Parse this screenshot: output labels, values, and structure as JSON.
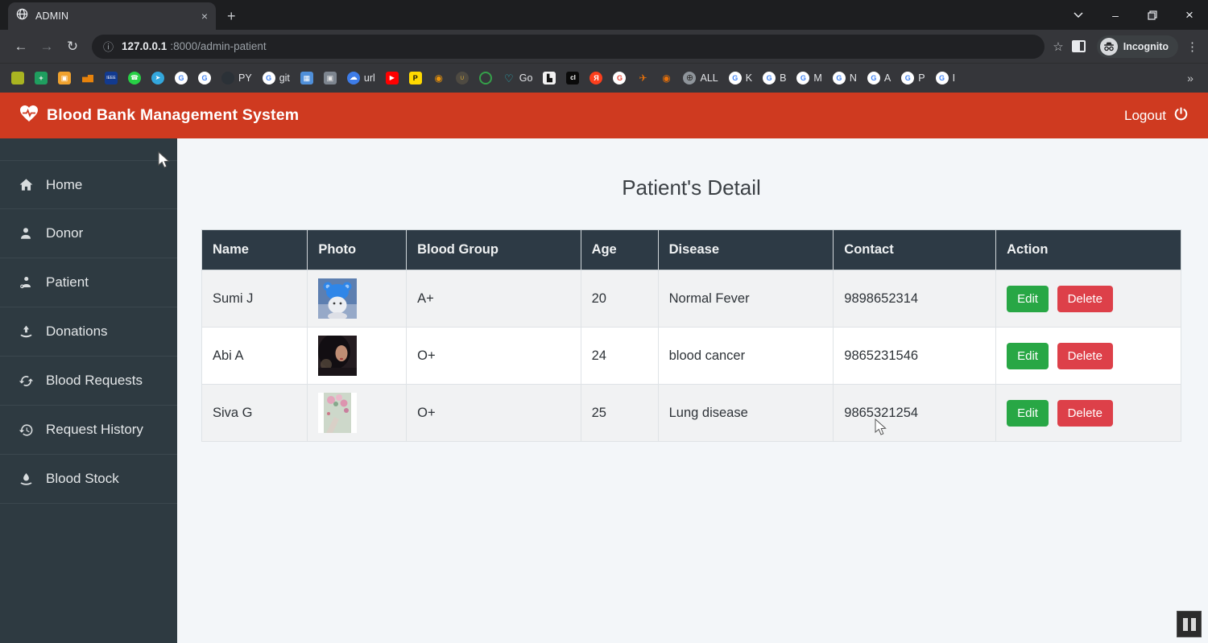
{
  "colors": {
    "accent_red": "#cf3a20",
    "sidebar_bg": "#2e3a41",
    "table_header_bg": "#2d3a45",
    "edit_green": "#28a745",
    "delete_red": "#dd4049",
    "content_bg": "#f3f6f9"
  },
  "icons": {
    "back": "←",
    "forward": "→",
    "reload": "↻",
    "info": "ⓘ",
    "star": "☆",
    "menu": "⋮",
    "minimize": "–",
    "close": "×",
    "new_tab": "+",
    "tab_close": "×"
  },
  "browser": {
    "tab_title": "ADMIN",
    "url": {
      "host": "127.0.0.1",
      "rest": ":8000/admin-patient"
    },
    "incognito_label": "Incognito",
    "bookmarks": [
      {
        "n": "tilted-bars-icon",
        "shape": "square",
        "bg": "#a9b421",
        "g": "",
        "fg": "#2f5d3a"
      },
      {
        "n": "sheets-icon",
        "shape": "square",
        "bg": "#1f9e5f",
        "g": "+",
        "fg": "#ffffff",
        "bold": 1
      },
      {
        "n": "orange-badge-icon",
        "shape": "square",
        "bg": "#f0a22e",
        "g": "▣",
        "fg": "#ffffff"
      },
      {
        "n": "analytics-icon",
        "shape": "none",
        "g": "▅▇",
        "fg": "#e8830c",
        "gs": 9
      },
      {
        "n": "ieee-icon",
        "shape": "square",
        "bg": "#123a8f",
        "g": "IEEE",
        "fg": "#ffffff",
        "gs": 5
      },
      {
        "n": "whatsapp-icon",
        "shape": "circle",
        "bg": "#27d045",
        "g": "☎",
        "fg": "#ffffff",
        "gs": 8
      },
      {
        "n": "telegram-icon",
        "shape": "circle",
        "bg": "#33a7dd",
        "g": "➤",
        "fg": "#ffffff",
        "gs": 8
      },
      {
        "n": "google-icon",
        "shape": "circle",
        "bg": "#ffffff",
        "g": "G",
        "fg": "#4285f4",
        "bold": 1
      },
      {
        "n": "google-icon",
        "shape": "circle",
        "bg": "#ffffff",
        "g": "G",
        "fg": "#4285f4",
        "bold": 1
      },
      {
        "n": "github-icon",
        "shape": "circle",
        "bg": "#2b3137",
        "g": "",
        "t": "PY"
      },
      {
        "n": "google-git-icon",
        "shape": "circle",
        "bg": "#ffffff",
        "g": "G",
        "fg": "#4285f4",
        "bold": 1,
        "t": "git"
      },
      {
        "n": "film-icon",
        "shape": "square",
        "bg": "#4f8fd9",
        "g": "▦",
        "fg": "#ffffff"
      },
      {
        "n": "camera-icon",
        "shape": "square",
        "bg": "#7d858f",
        "g": "▣",
        "fg": "#e9e9e9"
      },
      {
        "n": "cloud-url-icon",
        "shape": "circle",
        "bg": "#3d7ce8",
        "g": "☁",
        "fg": "#ffffff",
        "gs": 10,
        "t": "url"
      },
      {
        "n": "youtube-icon",
        "shape": "square",
        "bg": "#ff0000",
        "g": "▶",
        "fg": "#ffffff",
        "gs": 8
      },
      {
        "n": "p-icon",
        "shape": "square",
        "bg": "#ffd900",
        "g": "P",
        "fg": "#111111",
        "bold": 1
      },
      {
        "n": "movie-camera-icon",
        "shape": "none",
        "g": "◉",
        "fg": "#e8930c",
        "gs": 12
      },
      {
        "n": "cart-icon",
        "shape": "circle",
        "bg": "#4e4a42",
        "g": "∪",
        "fg": "#cfa43a",
        "gs": 8
      },
      {
        "n": "ring-icon",
        "shape": "ring",
        "border": "#35a04a"
      },
      {
        "n": "godaddy-icon",
        "shape": "none",
        "g": "♡",
        "fg": "#27b0bb",
        "gs": 13,
        "t": "Go"
      },
      {
        "n": "eagle-doc-icon",
        "shape": "square",
        "bg": "#f2f2f2",
        "g": "▙",
        "fg": "#141414"
      },
      {
        "n": "cl-icon",
        "shape": "square",
        "bg": "#0a0a0a",
        "g": "cl",
        "fg": "#ffffff",
        "gs": 8,
        "bold": 1
      },
      {
        "n": "yandex-icon",
        "shape": "circle",
        "bg": "#fc3f1d",
        "g": "Я",
        "fg": "#ffffff",
        "bold": 1
      },
      {
        "n": "google-colored-icon",
        "shape": "circle",
        "bg": "#ffffff",
        "g": "G",
        "fg": "#ea4335",
        "bold": 1
      },
      {
        "n": "paper-plane-icon",
        "shape": "none",
        "g": "✈",
        "fg": "#e8710a",
        "gs": 12
      },
      {
        "n": "eye-icon",
        "shape": "none",
        "g": "◉",
        "fg": "#e8710a",
        "gs": 12
      },
      {
        "n": "globe-all-icon",
        "shape": "circle",
        "bg": "#8f959b",
        "g": "⊕",
        "fg": "#2c2c2c",
        "gs": 11,
        "t": "ALL"
      },
      {
        "n": "google-k-icon",
        "shape": "circle",
        "bg": "#ffffff",
        "g": "G",
        "fg": "#4285f4",
        "bold": 1,
        "t": "K"
      },
      {
        "n": "google-b-icon",
        "shape": "circle",
        "bg": "#ffffff",
        "g": "G",
        "fg": "#4285f4",
        "bold": 1,
        "t": "B"
      },
      {
        "n": "google-m-icon",
        "shape": "circle",
        "bg": "#ffffff",
        "g": "G",
        "fg": "#4285f4",
        "bold": 1,
        "t": "M"
      },
      {
        "n": "google-n-icon",
        "shape": "circle",
        "bg": "#ffffff",
        "g": "G",
        "fg": "#4285f4",
        "bold": 1,
        "t": "N"
      },
      {
        "n": "google-a-icon",
        "shape": "circle",
        "bg": "#ffffff",
        "g": "G",
        "fg": "#4285f4",
        "bold": 1,
        "t": "A"
      },
      {
        "n": "google-p-icon",
        "shape": "circle",
        "bg": "#ffffff",
        "g": "G",
        "fg": "#4285f4",
        "bold": 1,
        "t": "P"
      },
      {
        "n": "google-i-icon",
        "shape": "circle",
        "bg": "#ffffff",
        "g": "G",
        "fg": "#4285f4",
        "bold": 1,
        "t": "I"
      },
      {
        "n": "bookmarks-overflow",
        "shape": "none",
        "g": "»",
        "fg": "#c7c9cc",
        "gs": 14,
        "end": 1
      }
    ]
  },
  "header": {
    "title": "Blood Bank Management System",
    "logout_label": "Logout"
  },
  "sidebar": {
    "items": [
      {
        "label": "Home"
      },
      {
        "label": "Donor"
      },
      {
        "label": "Patient"
      },
      {
        "label": "Donations"
      },
      {
        "label": "Blood Requests"
      },
      {
        "label": "Request History"
      },
      {
        "label": "Blood Stock"
      }
    ]
  },
  "main": {
    "title": "Patient's Detail",
    "table": {
      "headers": [
        "Name",
        "Photo",
        "Blood Group",
        "Age",
        "Disease",
        "Contact",
        "Action"
      ],
      "edit_label": "Edit",
      "delete_label": "Delete",
      "rows": [
        {
          "name": "Sumi J",
          "photo": "cat-wearing-blue-beanie",
          "blood_group": "A+",
          "age": "20",
          "disease": "Normal Fever",
          "contact": "9898652314"
        },
        {
          "name": "Abi A",
          "photo": "dark-haired-girl-portrait",
          "blood_group": "O+",
          "age": "24",
          "disease": "blood cancer",
          "contact": "9865231546"
        },
        {
          "name": "Siva G",
          "photo": "hand-with-pink-flowers",
          "blood_group": "O+",
          "age": "25",
          "disease": "Lung disease",
          "contact": "9865321254"
        }
      ]
    }
  }
}
